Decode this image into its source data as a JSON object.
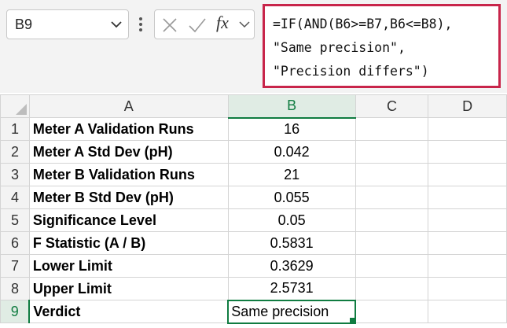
{
  "name_box": {
    "value": "B9"
  },
  "formula": {
    "lines": [
      "=IF(AND(B6>=B7,B6<=B8),",
      "\"Same precision\",",
      "\"Precision differs\")"
    ]
  },
  "icons": {
    "name_box_dropdown": "chevron-down-icon",
    "more": "more-vertical-icon",
    "cancel": "close-icon",
    "enter": "check-icon",
    "function": "fx-icon",
    "formula_expand": "chevron-down-icon"
  },
  "fx_label": "fx",
  "columns": [
    "A",
    "B",
    "C",
    "D"
  ],
  "rows": [
    {
      "num": "1",
      "label": "Meter A Validation Runs",
      "value": "16"
    },
    {
      "num": "2",
      "label": "Meter A Std Dev (pH)",
      "value": "0.042"
    },
    {
      "num": "3",
      "label": "Meter B Validation Runs",
      "value": "21"
    },
    {
      "num": "4",
      "label": "Meter B Std Dev (pH)",
      "value": "0.055"
    },
    {
      "num": "5",
      "label": "Significance Level",
      "value": "0.05"
    },
    {
      "num": "6",
      "label": "F Statistic (A / B)",
      "value": "0.5831"
    },
    {
      "num": "7",
      "label": "Lower Limit",
      "value": "0.3629"
    },
    {
      "num": "8",
      "label": "Upper Limit",
      "value": "2.5731"
    },
    {
      "num": "9",
      "label": "Verdict",
      "value": "Same precision"
    }
  ],
  "colors": {
    "accent": "#107c41",
    "formula_highlight": "#c8254a"
  }
}
